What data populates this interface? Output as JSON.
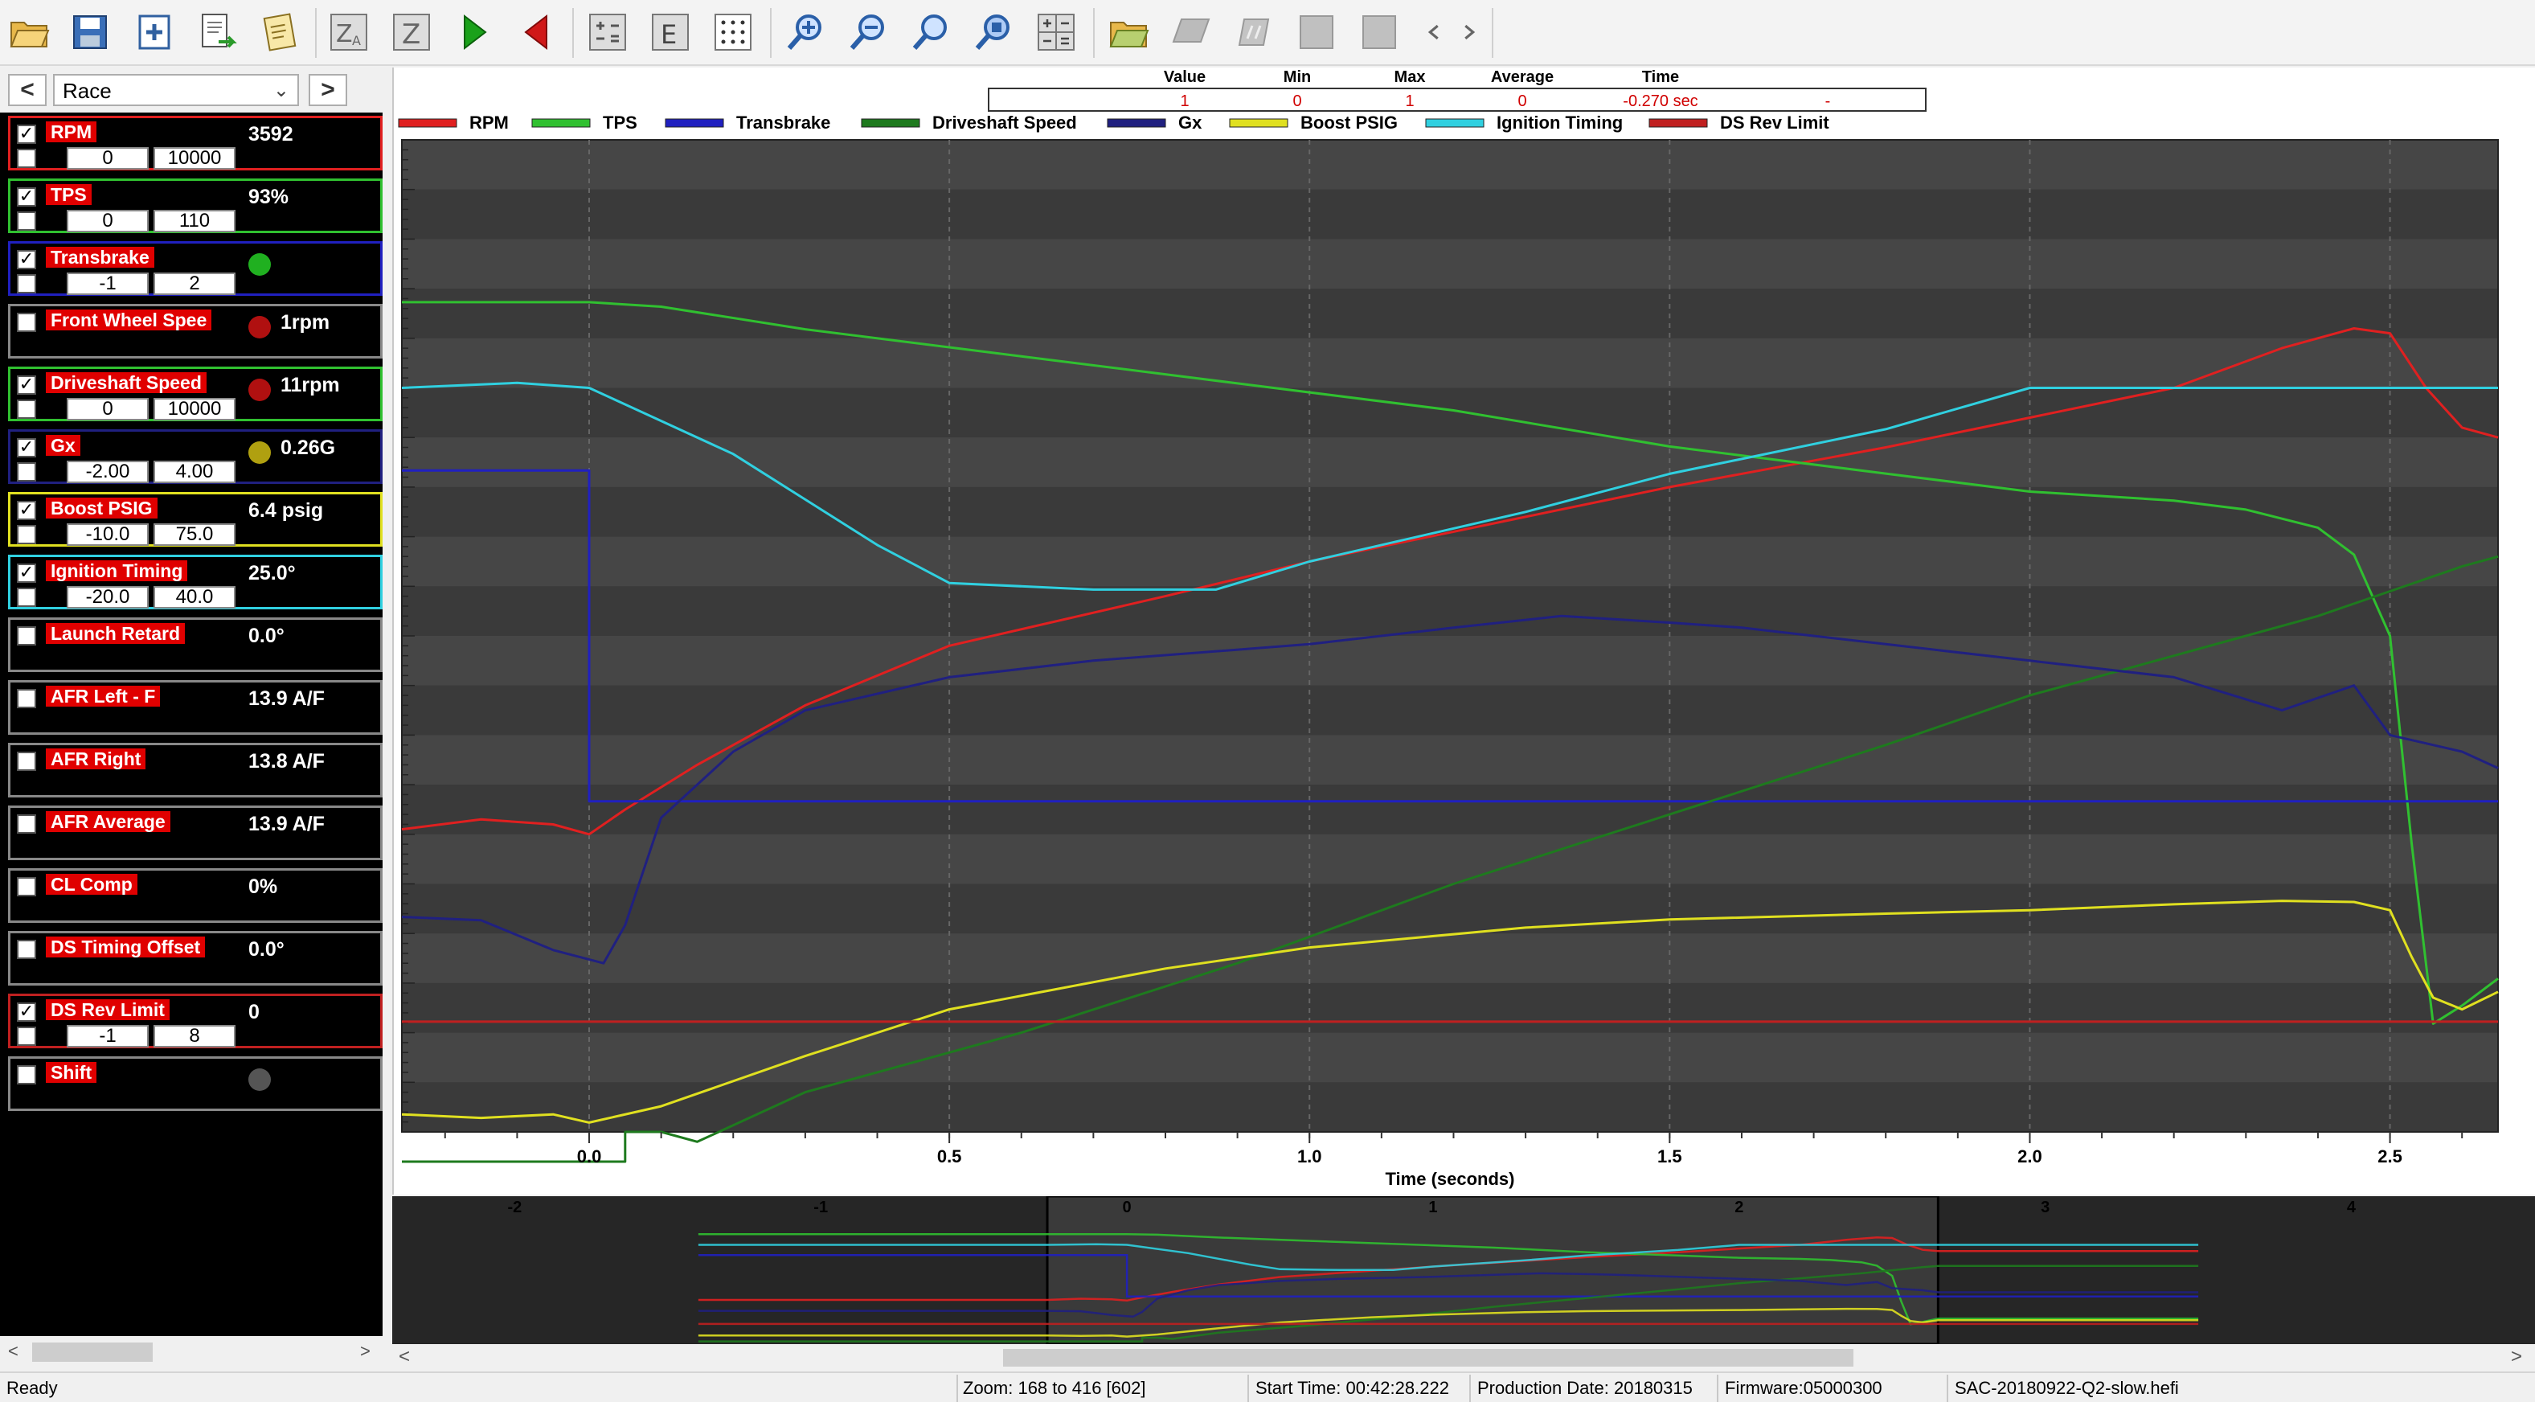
{
  "sidebar": {
    "preset": "Race",
    "channels": [
      {
        "name": "RPM",
        "checked": true,
        "value": "3592",
        "min": "0",
        "max": "10000",
        "color": "#e02020",
        "indicator": null
      },
      {
        "name": "TPS",
        "checked": true,
        "value": "93%",
        "min": "0",
        "max": "110",
        "color": "#30c030",
        "indicator": null
      },
      {
        "name": "Transbrake",
        "checked": true,
        "value": "",
        "min": "-1",
        "max": "2",
        "color": "#2020c0",
        "indicator": "#20b020"
      },
      {
        "name": "Front Wheel Spee",
        "checked": false,
        "value": "1rpm",
        "min": null,
        "max": null,
        "color": "#888888",
        "indicator": "#b01010"
      },
      {
        "name": "Driveshaft Speed",
        "checked": true,
        "value": "11rpm",
        "min": "0",
        "max": "10000",
        "color": "#30c030",
        "indicator": "#b01010"
      },
      {
        "name": "Gx",
        "checked": true,
        "value": "0.26G",
        "min": "-2.00",
        "max": "4.00",
        "color": "#202080",
        "indicator": "#b0a010"
      },
      {
        "name": "Boost PSIG",
        "checked": true,
        "value": "6.4 psig",
        "min": "-10.0",
        "max": "75.0",
        "color": "#e0e020",
        "indicator": null
      },
      {
        "name": "Ignition Timing",
        "checked": true,
        "value": "25.0°",
        "min": "-20.0",
        "max": "40.0",
        "color": "#30d0e0",
        "indicator": null
      },
      {
        "name": "Launch Retard",
        "checked": false,
        "value": "0.0°",
        "min": null,
        "max": null,
        "color": "#888888",
        "indicator": null
      },
      {
        "name": "AFR Left - F",
        "checked": false,
        "value": "13.9 A/F",
        "min": null,
        "max": null,
        "color": "#888888",
        "indicator": null
      },
      {
        "name": "AFR Right",
        "checked": false,
        "value": "13.8 A/F",
        "min": null,
        "max": null,
        "color": "#888888",
        "indicator": null
      },
      {
        "name": "AFR Average",
        "checked": false,
        "value": "13.9 A/F",
        "min": null,
        "max": null,
        "color": "#888888",
        "indicator": null
      },
      {
        "name": "CL Comp",
        "checked": false,
        "value": "0%",
        "min": null,
        "max": null,
        "color": "#888888",
        "indicator": null
      },
      {
        "name": "DS Timing Offset",
        "checked": false,
        "value": "0.0°",
        "min": null,
        "max": null,
        "color": "#888888",
        "indicator": null
      },
      {
        "name": "DS Rev Limit",
        "checked": true,
        "value": "0",
        "min": "-1",
        "max": "8",
        "color": "#c02020",
        "indicator": null
      },
      {
        "name": "Shift",
        "checked": false,
        "value": "",
        "min": null,
        "max": null,
        "color": "#888888",
        "indicator": "#555555"
      }
    ]
  },
  "cursor_table": {
    "headers": [
      "Value",
      "Min",
      "Max",
      "Average",
      "Time"
    ],
    "values": [
      "1",
      "0",
      "1",
      "0",
      "-0.270 sec",
      "-"
    ]
  },
  "status": {
    "ready": "Ready",
    "zoom": "Zoom: 168 to 416 [602]",
    "start_time": "Start Time: 00:42:28.222",
    "production_date": "Production Date: 20180315",
    "firmware": "Firmware:05000300",
    "file": "SAC-20180922-Q2-slow.hefi"
  },
  "chart_data": {
    "type": "line",
    "xlabel": "Time (seconds)",
    "x_ticks": [
      "0.0",
      "0.5",
      "1.0",
      "1.5",
      "2.0",
      "2.5"
    ],
    "xlim": [
      -0.26,
      2.65
    ],
    "overview_ticks": [
      "-2",
      "-1",
      "0",
      "1",
      "2",
      "3",
      "4"
    ],
    "overview_xlim": [
      -2.4,
      4.6
    ],
    "overview_window": [
      -0.26,
      2.65
    ],
    "series": [
      {
        "name": "RPM",
        "color": "#e02020",
        "points": [
          [
            -0.26,
            3050
          ],
          [
            -0.15,
            3150
          ],
          [
            -0.05,
            3100
          ],
          [
            0.0,
            3000
          ],
          [
            0.05,
            3250
          ],
          [
            0.15,
            3700
          ],
          [
            0.3,
            4300
          ],
          [
            0.5,
            4900
          ],
          [
            0.8,
            5400
          ],
          [
            1.0,
            5750
          ],
          [
            1.3,
            6200
          ],
          [
            1.5,
            6500
          ],
          [
            1.8,
            6900
          ],
          [
            2.0,
            7200
          ],
          [
            2.2,
            7500
          ],
          [
            2.35,
            7900
          ],
          [
            2.45,
            8100
          ],
          [
            2.5,
            8050
          ],
          [
            2.55,
            7500
          ],
          [
            2.6,
            7100
          ],
          [
            2.65,
            7000
          ]
        ]
      },
      {
        "name": "TPS",
        "color": "#30c030",
        "points": [
          [
            -0.26,
            92
          ],
          [
            0.0,
            92
          ],
          [
            0.1,
            91.5
          ],
          [
            0.3,
            89
          ],
          [
            0.6,
            86
          ],
          [
            0.9,
            83
          ],
          [
            1.2,
            80
          ],
          [
            1.5,
            76
          ],
          [
            1.8,
            73
          ],
          [
            2.0,
            71
          ],
          [
            2.2,
            70
          ],
          [
            2.3,
            69
          ],
          [
            2.4,
            67
          ],
          [
            2.45,
            64
          ],
          [
            2.5,
            55
          ],
          [
            2.53,
            32
          ],
          [
            2.56,
            12
          ],
          [
            2.6,
            14
          ],
          [
            2.65,
            17
          ]
        ]
      },
      {
        "name": "Transbrake",
        "color": "#2020c0",
        "points": [
          [
            -0.26,
            1
          ],
          [
            0.0,
            1
          ],
          [
            0.0,
            0
          ],
          [
            2.65,
            0
          ]
        ]
      },
      {
        "name": "Driveshaft Speed",
        "color": "#1e7a1e",
        "points": [
          [
            -0.26,
            -300
          ],
          [
            0.05,
            -300
          ],
          [
            0.05,
            0
          ],
          [
            0.1,
            0
          ],
          [
            0.15,
            -100
          ],
          [
            0.3,
            400
          ],
          [
            0.6,
            1000
          ],
          [
            0.9,
            1700
          ],
          [
            1.2,
            2500
          ],
          [
            1.5,
            3200
          ],
          [
            1.8,
            3900
          ],
          [
            2.0,
            4400
          ],
          [
            2.2,
            4800
          ],
          [
            2.3,
            5000
          ],
          [
            2.4,
            5200
          ],
          [
            2.5,
            5450
          ],
          [
            2.6,
            5700
          ],
          [
            2.65,
            5800
          ]
        ]
      },
      {
        "name": "Gx",
        "color": "#202080",
        "points": [
          [
            -0.26,
            -0.7
          ],
          [
            -0.15,
            -0.72
          ],
          [
            -0.05,
            -0.9
          ],
          [
            0.02,
            -0.98
          ],
          [
            0.05,
            -0.75
          ],
          [
            0.1,
            -0.1
          ],
          [
            0.2,
            0.3
          ],
          [
            0.3,
            0.55
          ],
          [
            0.5,
            0.75
          ],
          [
            0.7,
            0.85
          ],
          [
            1.0,
            0.95
          ],
          [
            1.2,
            1.05
          ],
          [
            1.35,
            1.12
          ],
          [
            1.5,
            1.08
          ],
          [
            1.6,
            1.05
          ],
          [
            1.8,
            0.95
          ],
          [
            2.0,
            0.85
          ],
          [
            2.2,
            0.75
          ],
          [
            2.35,
            0.55
          ],
          [
            2.45,
            0.7
          ],
          [
            2.5,
            0.4
          ],
          [
            2.55,
            0.35
          ],
          [
            2.6,
            0.3
          ],
          [
            2.65,
            0.2
          ]
        ]
      },
      {
        "name": "Boost PSIG",
        "color": "#e0e020",
        "points": [
          [
            -0.26,
            -8.5
          ],
          [
            -0.15,
            -8.8
          ],
          [
            -0.05,
            -8.5
          ],
          [
            0.0,
            -9.2
          ],
          [
            0.1,
            -7.8
          ],
          [
            0.3,
            -3.5
          ],
          [
            0.5,
            0.5
          ],
          [
            0.8,
            4.0
          ],
          [
            1.0,
            5.8
          ],
          [
            1.3,
            7.5
          ],
          [
            1.5,
            8.2
          ],
          [
            1.8,
            8.7
          ],
          [
            2.0,
            9.0
          ],
          [
            2.2,
            9.5
          ],
          [
            2.35,
            9.8
          ],
          [
            2.45,
            9.7
          ],
          [
            2.5,
            9.0
          ],
          [
            2.53,
            5.0
          ],
          [
            2.56,
            1.5
          ],
          [
            2.6,
            0.5
          ],
          [
            2.65,
            2.0
          ]
        ]
      },
      {
        "name": "Ignition Timing",
        "color": "#30d0e0",
        "points": [
          [
            -0.26,
            25.0
          ],
          [
            -0.1,
            25.3
          ],
          [
            0.0,
            25.0
          ],
          [
            0.2,
            21.0
          ],
          [
            0.4,
            15.5
          ],
          [
            0.5,
            13.2
          ],
          [
            0.7,
            12.8
          ],
          [
            0.87,
            12.8
          ],
          [
            1.0,
            14.5
          ],
          [
            1.3,
            17.5
          ],
          [
            1.5,
            19.8
          ],
          [
            1.8,
            22.5
          ],
          [
            2.0,
            25.0
          ],
          [
            2.65,
            25.0
          ]
        ]
      },
      {
        "name": "DS Rev Limit",
        "color": "#c02020",
        "points": [
          [
            -0.26,
            0
          ],
          [
            2.65,
            0
          ]
        ]
      }
    ]
  }
}
